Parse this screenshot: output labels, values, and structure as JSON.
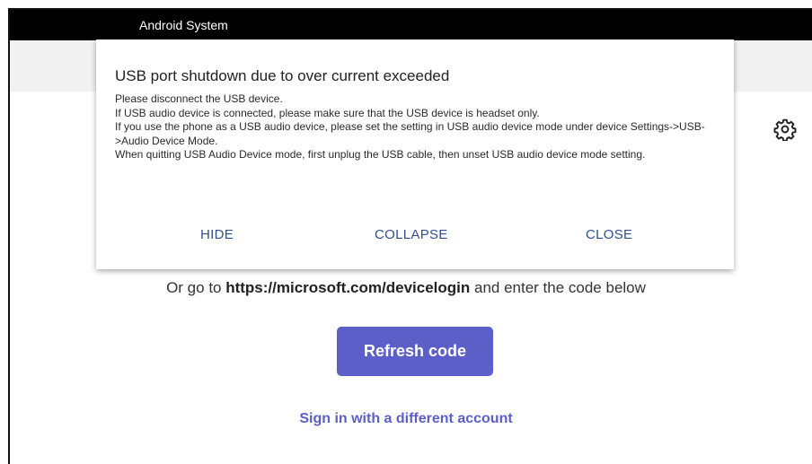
{
  "status_bar": {
    "title": "Android System",
    "background": "#000000"
  },
  "dialog": {
    "title": "USB port shutdown due to over current exceeded",
    "body_lines": [
      "Please disconnect the USB device.",
      "If USB audio device is connected, please make sure that the USB device is headset only.",
      "If you use the phone as a USB audio device, please set the setting in USB audio device mode under device Settings->USB->Audio Device Mode.",
      "When quitting USB Audio Device mode, first unplug the USB cable, then unset USB audio device mode setting."
    ],
    "buttons": {
      "hide": "HIDE",
      "collapse": "COLLAPSE",
      "close": "CLOSE"
    }
  },
  "main": {
    "devicelogin_prefix": "Or go to ",
    "devicelogin_url": "https://microsoft.com/devicelogin",
    "devicelogin_suffix": " and enter the code below",
    "refresh_label": "Refresh code",
    "signin_other_label": "Sign in with a different account",
    "settings_icon": "gear-icon"
  },
  "colors": {
    "accent": "#5b5fc7",
    "dialog_button": "#2f4f8f",
    "header_bg": "#f1f1f1"
  }
}
